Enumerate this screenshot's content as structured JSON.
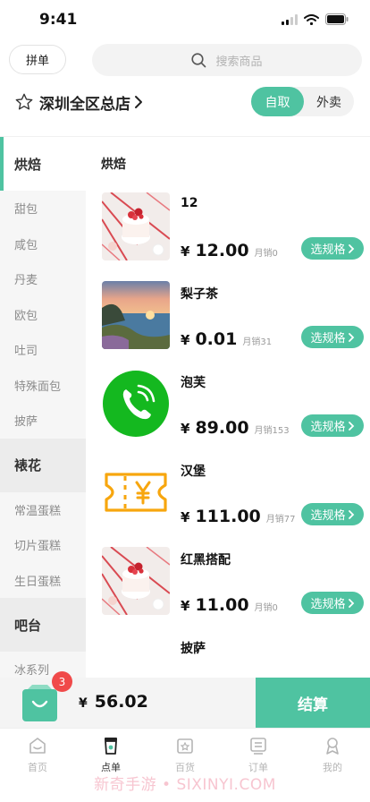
{
  "status_bar": {
    "time": "9:41"
  },
  "header": {
    "group_button": "拼单",
    "search_placeholder": "搜索商品"
  },
  "store": {
    "name": "深圳全区总店",
    "modes": {
      "pickup": "自取",
      "delivery": "外卖",
      "selected": "pickup"
    }
  },
  "sidebar": {
    "groups": [
      {
        "label": "烘焙",
        "active": true,
        "items": [
          "甜包",
          "咸包",
          "丹麦",
          "欧包",
          "吐司",
          "特殊面包",
          "披萨"
        ]
      },
      {
        "label": "裱花",
        "active": false,
        "items": [
          "常温蛋糕",
          "切片蛋糕",
          "生日蛋糕"
        ]
      },
      {
        "label": "吧台",
        "active": false,
        "items": [
          "冰系列"
        ]
      }
    ]
  },
  "section": {
    "title": "烘焙"
  },
  "products": [
    {
      "name": "12",
      "price_symbol": "¥",
      "price": "12.00",
      "sales": "月销0",
      "button": "选规格",
      "image": "cake-photo"
    },
    {
      "name": "梨子茶",
      "price_symbol": "¥",
      "price": "0.01",
      "sales": "月销31",
      "button": "选规格",
      "image": "coast-sunset-photo"
    },
    {
      "name": "泡芙",
      "price_symbol": "¥",
      "price": "89.00",
      "sales": "月销153",
      "button": "选规格",
      "image": "phone-call-icon"
    },
    {
      "name": "汉堡",
      "price_symbol": "¥",
      "price": "111.00",
      "sales": "月销77",
      "button": "选规格",
      "image": "yen-ticket-icon"
    },
    {
      "name": "红黑搭配",
      "price_symbol": "¥",
      "price": "11.00",
      "sales": "月销0",
      "button": "选规格",
      "image": "cake-photo"
    },
    {
      "name": "披萨"
    }
  ],
  "cart": {
    "count": "3",
    "total_symbol": "¥",
    "total": "56.02",
    "checkout_label": "结算"
  },
  "tabbar": {
    "tabs": [
      {
        "label": "首页",
        "icon": "home-icon"
      },
      {
        "label": "点单",
        "icon": "order-cup-icon",
        "active": true
      },
      {
        "label": "百货",
        "icon": "store-icon"
      },
      {
        "label": "订单",
        "icon": "order-list-icon"
      },
      {
        "label": "我的",
        "icon": "profile-icon"
      }
    ]
  },
  "watermark": "新奇手游 • SIXINYI.COM",
  "colors": {
    "accent": "#4fc3a1",
    "badge": "#f04a4a",
    "call_green": "#14b81f",
    "ticket_orange": "#f7a60e"
  }
}
